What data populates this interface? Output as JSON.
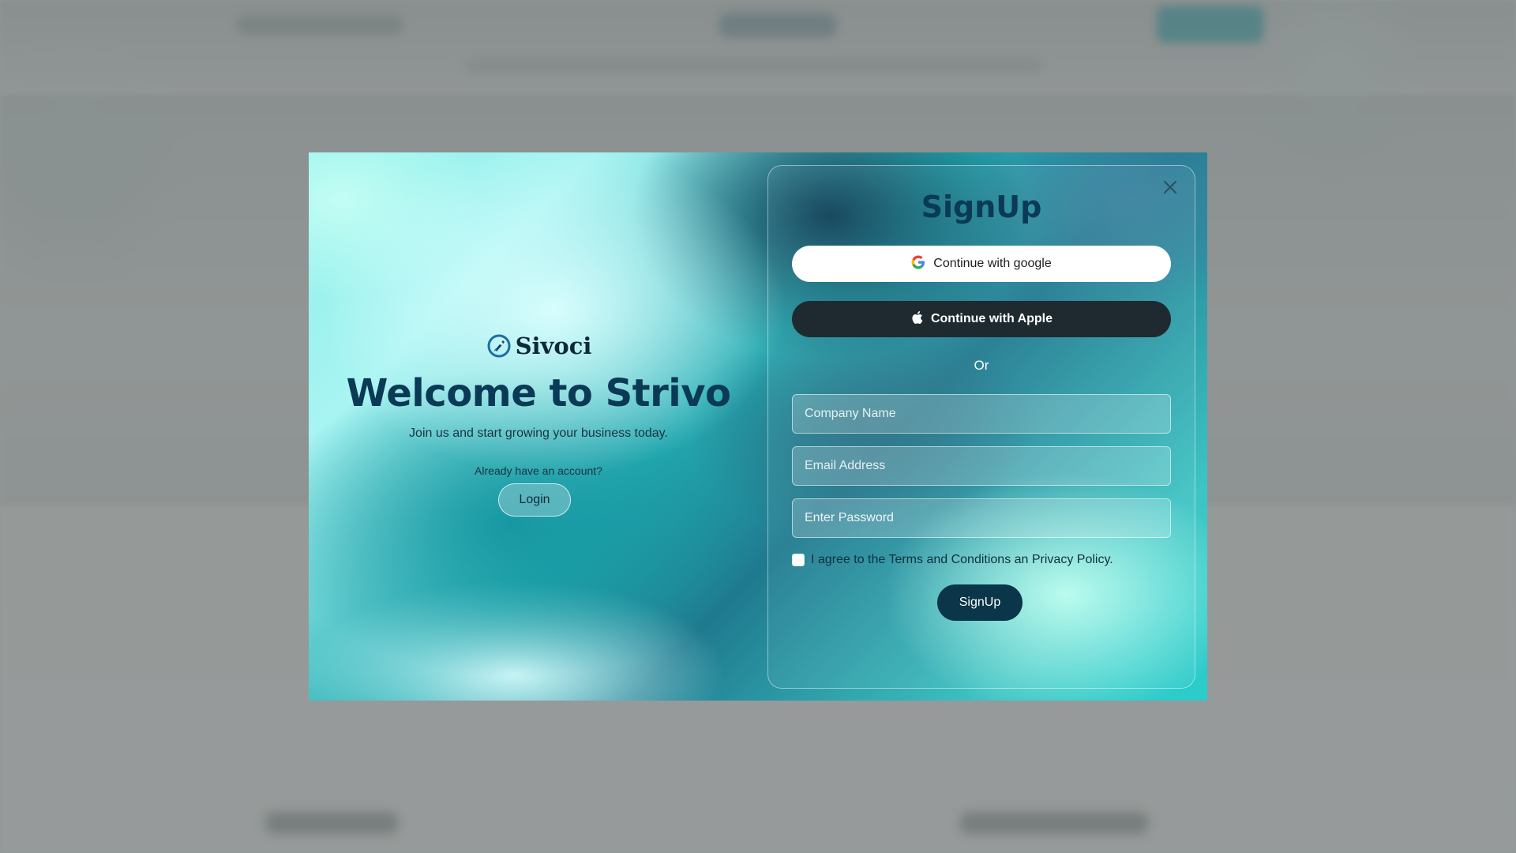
{
  "modal": {
    "left": {
      "brand_name": "Sivoci",
      "heading": "Welcome to Strivo",
      "subtitle": "Join us and start growing your business today.",
      "account_prompt": "Already have an account?",
      "login_label": "Login"
    },
    "form": {
      "title": "SignUp",
      "google_label": "Continue with google",
      "apple_label": "Continue with Apple",
      "divider_text": "Or",
      "company_placeholder": "Company Name",
      "email_placeholder": "Email Address",
      "password_placeholder": "Enter Password",
      "agree_text": "I agree to the Terms and Conditions an Privacy Policy.",
      "agree_checked": false,
      "submit_label": "SignUp"
    },
    "icons": {
      "close": "close-icon",
      "google": "google-icon",
      "apple": "apple-icon",
      "brand": "rocket-logo-icon"
    },
    "colors": {
      "primary_dark": "#0b3549",
      "heading": "#0a3a56",
      "apple_button": "#1f2a30"
    }
  }
}
